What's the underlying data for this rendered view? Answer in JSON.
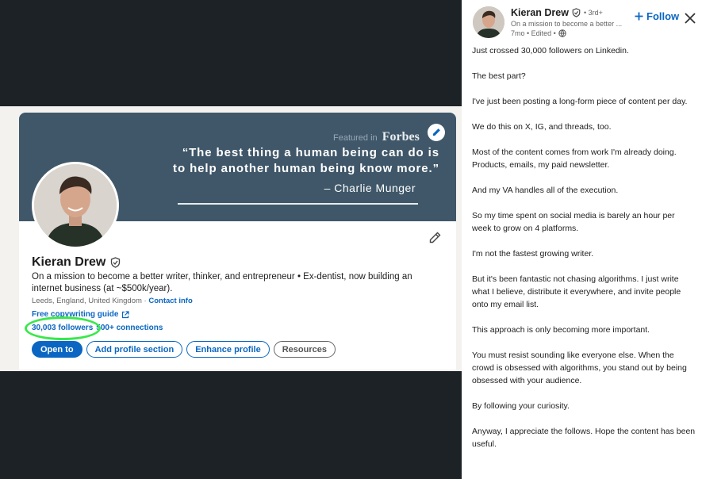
{
  "banner": {
    "featured_label": "Featured in",
    "featured_brand": "Forbes",
    "quote_line1": "“The best thing a human being can do is",
    "quote_line2": "to help another human being know more.”",
    "quote_author": "– Charlie Munger"
  },
  "profile": {
    "name": "Kieran Drew",
    "headline": "On a mission to become a better writer, thinker, and entrepreneur • Ex-dentist, now building an internet business (at ~$500k/year).",
    "location": "Leeds, England, United Kingdom",
    "separator": " · ",
    "contact_info": "Contact info",
    "link_label": "Free copywriting guide",
    "followers": "30,003 followers",
    "connections": "500+ connections",
    "buttons": [
      "Open to",
      "Add profile section",
      "Enhance profile",
      "Resources"
    ]
  },
  "post": {
    "author_name": "Kieran Drew",
    "author_degree": "• 3rd+",
    "author_headline": "On a mission to become a better ...",
    "meta_time": "7mo • Edited •",
    "follow_label": "Follow",
    "paragraphs": [
      "Just crossed 30,000 followers on Linkedin.",
      "The best part?",
      "I've just been posting a long-form piece of content per day.",
      "We do this on X, IG, and threads, too.",
      "Most of the content comes from work I'm already doing. Products, emails, my paid newsletter.",
      "And my VA handles all of the execution.",
      "So my time spent on social media is barely an hour per week to grow on 4 platforms.",
      "I'm not the fastest growing writer.",
      "But it's been fantastic not chasing algorithms. I just write what I believe, distribute it everywhere, and invite people onto my email list.",
      "This approach is only becoming more important.",
      "You must resist sounding like everyone else. When the crowd is obsessed with algorithms, you stand out by being obsessed with your audience.",
      "By following your curiosity.",
      "Anyway, I appreciate the follows. Hope the content has been useful."
    ]
  },
  "colors": {
    "brand_blue": "#0a66c2",
    "banner": "#3f5769",
    "highlight": "#39e84a",
    "viewer_bg": "#1d2226"
  },
  "icons": [
    "pencil-icon",
    "verified-shield-icon",
    "external-link-icon",
    "plus-icon",
    "close-icon",
    "globe-icon"
  ]
}
